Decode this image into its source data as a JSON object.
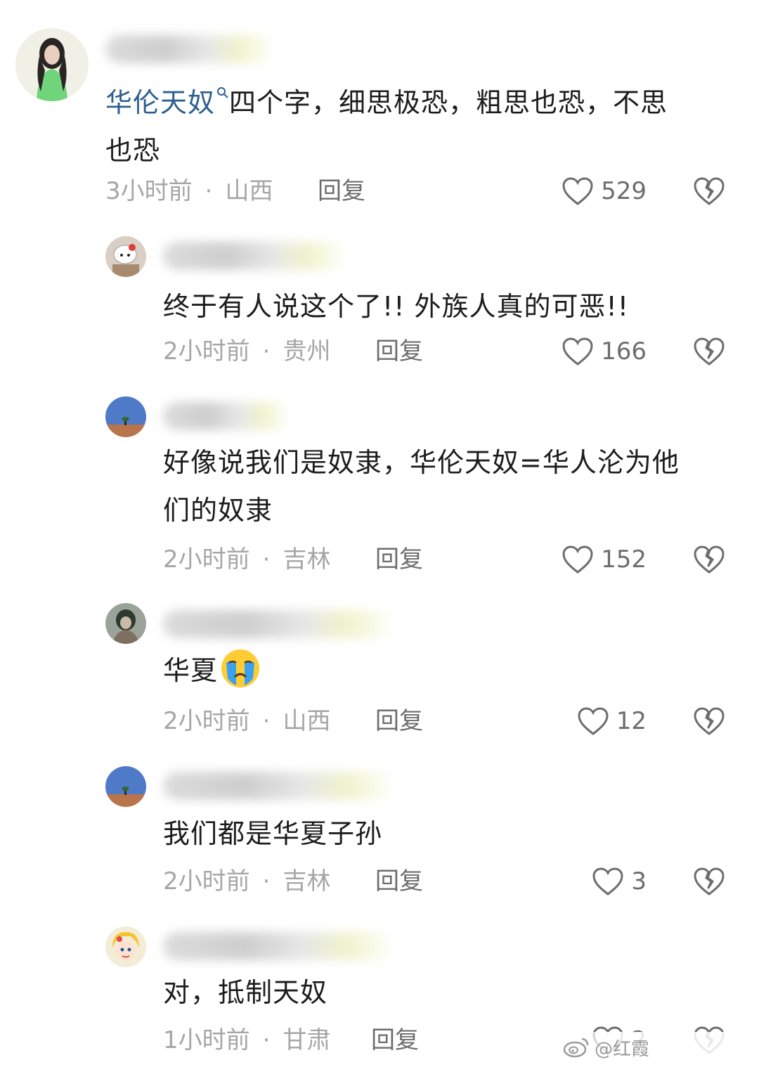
{
  "comments": [
    {
      "mention": "华伦天奴",
      "mention_icon": "search-icon",
      "text": "四个字，细思极恐，粗思也恐，不思",
      "text_line2": "也恐",
      "time": "3小时前",
      "separator": "·",
      "location": "山西",
      "reply": "回复",
      "likes": "529",
      "avatar": "avatar-girl-green-shirt"
    },
    {
      "text": "终于有人说这个了!! 外族人真的可恶!!",
      "time": "2小时前",
      "separator": "·",
      "location": "贵州",
      "reply": "回复",
      "likes": "166",
      "avatar": "avatar-hello-kitty"
    },
    {
      "text": "好像说我们是奴隶，华伦天奴=华人沦为他",
      "text_line2": "们的奴隶",
      "time": "2小时前",
      "separator": "·",
      "location": "吉林",
      "reply": "回复",
      "likes": "152",
      "avatar": "avatar-blue-sky-tree"
    },
    {
      "text": "华夏",
      "emoji": "crying-face-emoji",
      "time": "2小时前",
      "separator": "·",
      "location": "山西",
      "reply": "回复",
      "likes": "12",
      "avatar": "avatar-dark-figure"
    },
    {
      "text": "我们都是华夏子孙",
      "time": "2小时前",
      "separator": "·",
      "location": "吉林",
      "reply": "回复",
      "likes": "3",
      "avatar": "avatar-blue-sky-tree"
    },
    {
      "text": "对，抵制天奴",
      "time": "1小时前",
      "separator": "·",
      "location": "甘肃",
      "reply": "回复",
      "likes": "2",
      "avatar": "avatar-cartoon-girl"
    }
  ],
  "watermark": {
    "text": "@红霞",
    "logo": "weibo-logo"
  },
  "colors": {
    "mention": "#2e5f8f",
    "meta": "#a6a6a6",
    "action": "#6d6d6d",
    "text": "#1c1c1c"
  }
}
